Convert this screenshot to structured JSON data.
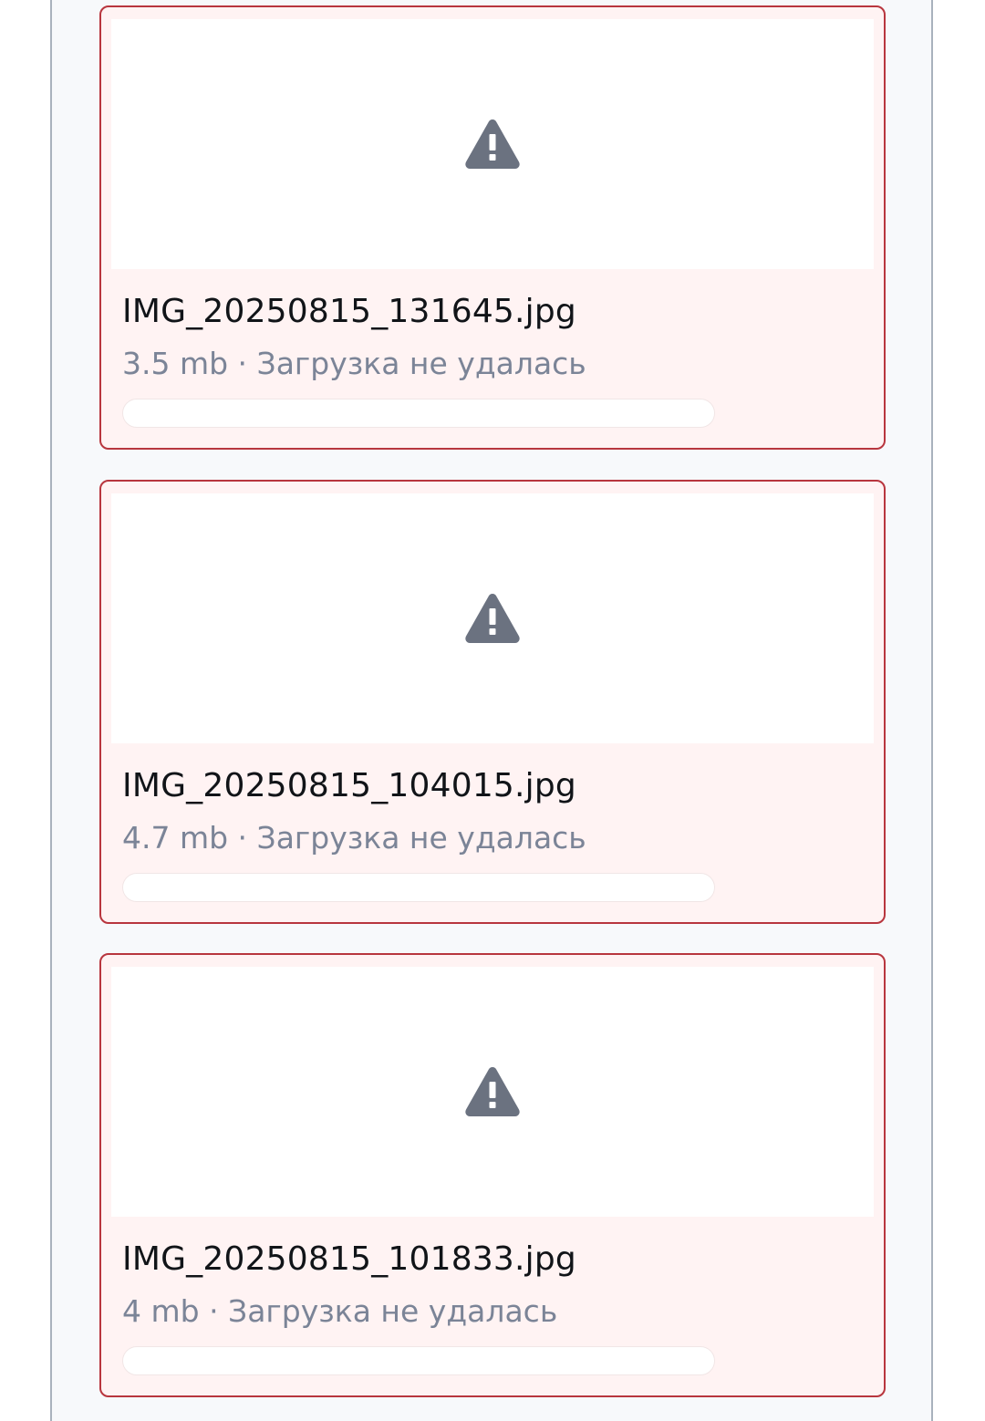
{
  "colors": {
    "error_border": "#b8363e",
    "card_bg": "#fff3f3",
    "icon": "#6b7280",
    "meta_text": "#7b8497"
  },
  "files": [
    {
      "name": "IMG_20250815_131645.jpg",
      "size": "3.5 mb",
      "separator": "·",
      "status": "Загрузка не удалась",
      "meta": "3.5 mb · Загрузка не удалась",
      "progress": 0,
      "icon": "warning-icon"
    },
    {
      "name": "IMG_20250815_104015.jpg",
      "size": "4.7 mb",
      "separator": "·",
      "status": "Загрузка не удалась",
      "meta": "4.7 mb · Загрузка не удалась",
      "progress": 0,
      "icon": "warning-icon"
    },
    {
      "name": "IMG_20250815_101833.jpg",
      "size": "4 mb",
      "separator": "·",
      "status": "Загрузка не удалась",
      "meta": "4 mb · Загрузка не удалась",
      "progress": 0,
      "icon": "warning-icon"
    }
  ]
}
